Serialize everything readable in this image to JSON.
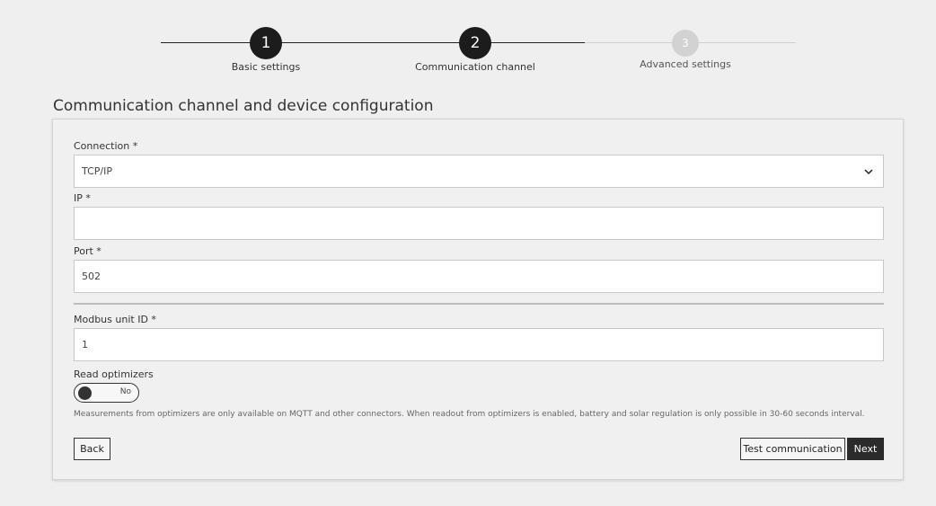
{
  "stepper": {
    "steps": [
      {
        "number": "1",
        "label": "Basic settings",
        "state": "completed"
      },
      {
        "number": "2",
        "label": "Communication channel",
        "state": "active"
      },
      {
        "number": "3",
        "label": "Advanced settings",
        "state": "inactive"
      }
    ]
  },
  "page": {
    "title": "Communication channel and device configuration"
  },
  "form": {
    "connection": {
      "label": "Connection *",
      "value": "TCP/IP"
    },
    "ip": {
      "label": "IP *",
      "value": ""
    },
    "port": {
      "label": "Port *",
      "value": "502"
    },
    "modbus_unit_id": {
      "label": "Modbus unit ID *",
      "value": "1"
    },
    "read_optimizers": {
      "label": "Read optimizers",
      "toggle_text": "No",
      "enabled": false
    },
    "note": "Measurements from optimizers are only available on MQTT and other connectors. When readout from optimizers is enabled, battery and solar regulation is only possible in 30-60 seconds interval."
  },
  "buttons": {
    "back": "Back",
    "test": "Test communication",
    "next": "Next"
  },
  "colors": {
    "accent": "#1c1c1c",
    "inactive_step": "#d2d2d2",
    "background": "#efefef"
  }
}
